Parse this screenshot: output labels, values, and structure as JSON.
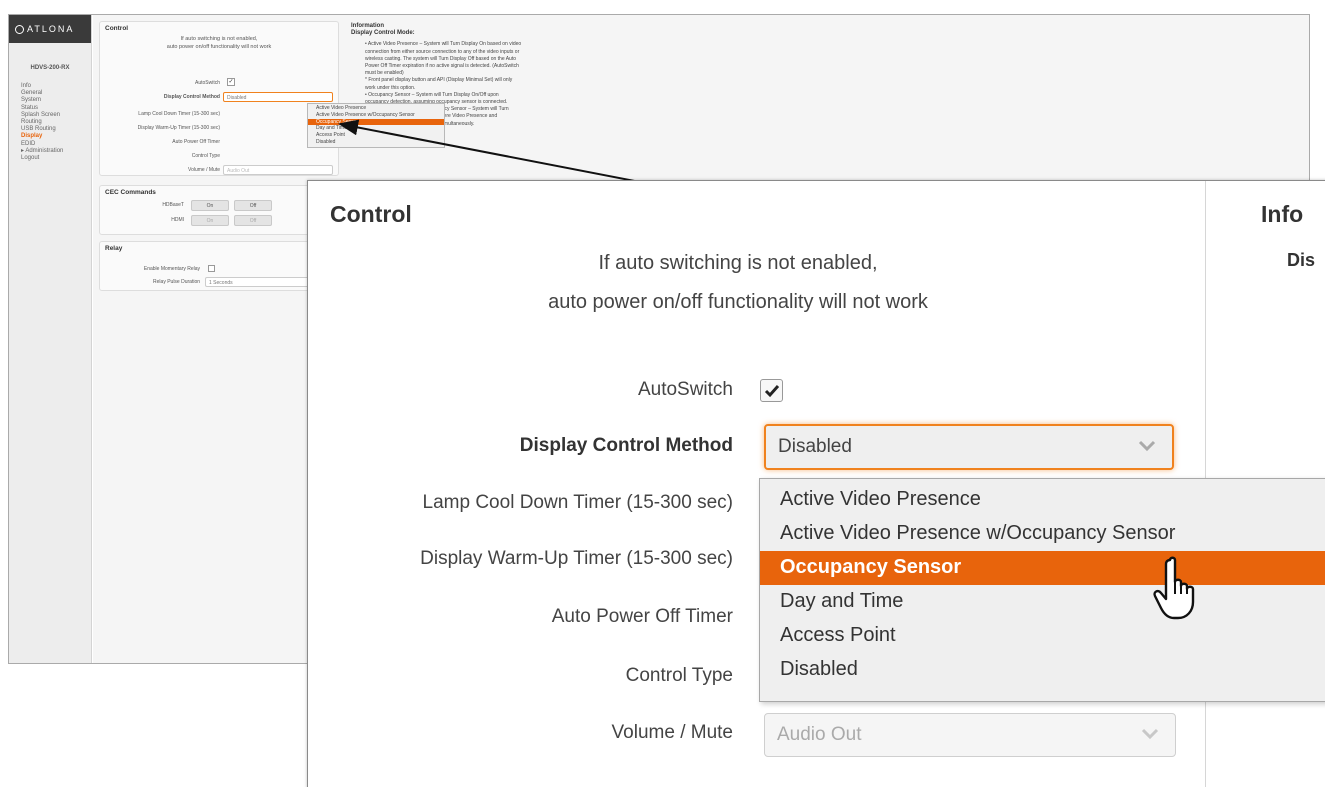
{
  "mini": {
    "logo": "ATLONA",
    "model": "HDVS-200-RX",
    "nav": [
      "Info",
      "General",
      "System",
      "Status",
      "Splash Screen",
      "Routing",
      "USB Routing",
      "Display",
      "EDID",
      "▸ Administration",
      "Logout"
    ],
    "active_nav": "Display",
    "control_title": "Control",
    "notice_line1": "If auto switching is not enabled,",
    "notice_line2": "auto power on/off functionality will not work",
    "rows": {
      "autoswitch": "AutoSwitch",
      "display_control": "Display Control Method",
      "lamp": "Lamp Cool Down Timer (15-300 sec)",
      "warmup": "Display Warm-Up Timer (15-300 sec)",
      "auto_power": "Auto Power Off Timer",
      "control_type": "Control Type",
      "volume": "Volume / Mute"
    },
    "select_value": "Disabled",
    "audio_value": "Audio Out",
    "dropdown": [
      "Active Video Presence",
      "Active Video Presence w/Occupancy Sensor",
      "Occupancy Sensor",
      "Day and Time",
      "Access Point",
      "Disabled"
    ],
    "cec_title": "CEC Commands",
    "cec_hdbaset": "HDBaseT",
    "cec_hdmi": "HDMI",
    "btn_on": "On",
    "btn_off": "Off",
    "relay_title": "Relay",
    "relay_enable": "Enable Momentary Relay",
    "relay_pulse": "Relay Pulse Duration",
    "relay_value": "1 Seconds",
    "info_title": "Information",
    "info_sub": "Display Control Mode:",
    "info_lines": [
      "• Active Video Presence – System will Turn Display On based on video",
      "connection from either source connection to any of the video inputs or",
      "wireless casting. The system will Turn Display Off based on the Auto",
      "Power Off Timer expiration if no active signal is detected. (AutoSwitch",
      "must be enabled)",
      "* Front panel display button and API (Display Minimal Set) will only",
      "work under this option.",
      "• Occupancy Sensor – System will Turn Display On/Off upon",
      "occupancy detection, assuming occupancy sensor is connected.",
      "• Active Video Presence w/Occupancy Sensor – System will Turn",
      "Display On/Off in a hybrid mode where Video Presence and",
      "Occupancy sensor could be used simultaneously."
    ]
  },
  "zoom": {
    "title": "Control",
    "info_title": "Info",
    "info_sub": "Dis",
    "notice_line1": "If auto switching is not enabled,",
    "notice_line2": "auto power on/off functionality will not work",
    "labels": {
      "autoswitch": "AutoSwitch",
      "display_control": "Display Control Method",
      "lamp": "Lamp Cool Down Timer (15-300 sec)",
      "warmup": "Display Warm-Up Timer (15-300 sec)",
      "auto_power": "Auto Power Off Timer",
      "control_type": "Control Type",
      "volume": "Volume / Mute"
    },
    "autoswitch_checked": true,
    "select_value": "Disabled",
    "audio_value": "Audio Out",
    "dropdown": [
      "Active Video Presence",
      "Active Video Presence w/Occupancy Sensor",
      "Occupancy Sensor",
      "Day and Time",
      "Access Point",
      "Disabled"
    ],
    "selected_option": "Occupancy Sensor"
  },
  "colors": {
    "accent": "#e8640c",
    "focus_border": "#f0821e",
    "sidebar_bg": "#ededed",
    "logo_bg": "#3a3a3a"
  }
}
